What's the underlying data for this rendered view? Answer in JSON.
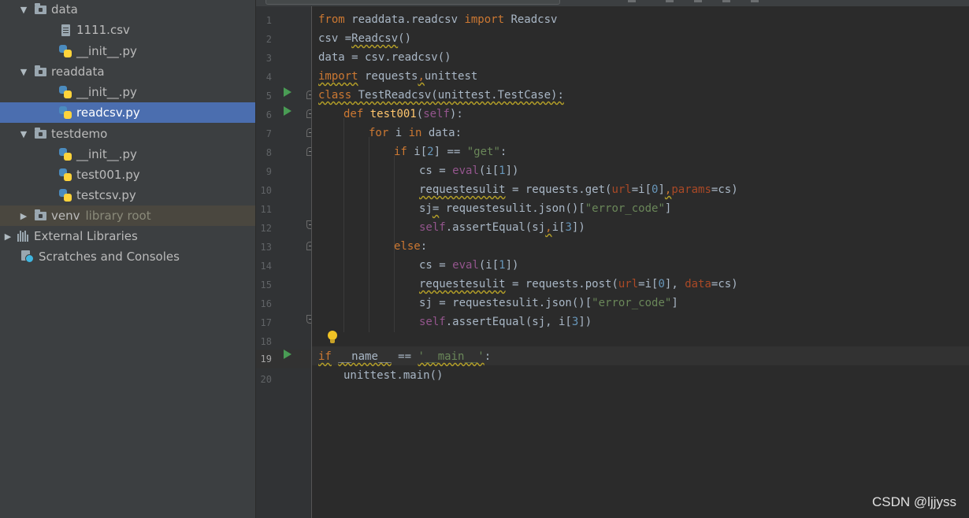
{
  "project_tree": {
    "items": [
      {
        "label": "data",
        "extra": "",
        "type": "folder",
        "expanded": true
      },
      {
        "label": "1111.csv",
        "extra": "",
        "type": "file-csv"
      },
      {
        "label": "__init__.py",
        "extra": "",
        "type": "file-py"
      },
      {
        "label": "readdata",
        "extra": "",
        "type": "folder",
        "expanded": true
      },
      {
        "label": "__init__.py",
        "extra": "",
        "type": "file-py"
      },
      {
        "label": "readcsv.py",
        "extra": "",
        "type": "file-py",
        "selected": true
      },
      {
        "label": "testdemo",
        "extra": "",
        "type": "folder",
        "expanded": true
      },
      {
        "label": "__init__.py",
        "extra": "",
        "type": "file-py"
      },
      {
        "label": "test001.py",
        "extra": "",
        "type": "file-py"
      },
      {
        "label": "testcsv.py",
        "extra": "",
        "type": "file-py"
      },
      {
        "label": "venv",
        "extra": "library root",
        "type": "folder",
        "expanded": false
      },
      {
        "label": "External Libraries",
        "extra": "",
        "type": "libraries",
        "expanded": false
      },
      {
        "label": "Scratches and Consoles",
        "extra": "",
        "type": "scratches"
      }
    ]
  },
  "editor": {
    "line_numbers": [
      "1",
      "2",
      "3",
      "4",
      "5",
      "6",
      "7",
      "8",
      "9",
      "10",
      "11",
      "12",
      "13",
      "14",
      "15",
      "16",
      "17",
      "18",
      "19",
      "20"
    ],
    "current_line": 19,
    "tokens": {
      "l1a": "from",
      "l1b": " readdata.readcsv ",
      "l1c": "import",
      "l1d": " Readcsv",
      "l2a": "csv =",
      "l2b": "Readcsv",
      "l2c": "()",
      "l3a": "data = csv.readcsv()",
      "l4a": "import",
      "l4b": " requests",
      "l4c": ",",
      "l4d": "unittest",
      "l5a": "class",
      "l5b": " TestReadcsv(unittest.TestCase):",
      "l6a": "def",
      "l6b": " ",
      "l6c": "test001",
      "l6d": "(",
      "l6e": "self",
      "l6f": "):",
      "l7a": "for",
      "l7b": " i ",
      "l7c": "in",
      "l7d": " data:",
      "l8a": "if",
      "l8b": " i[",
      "l8c": "2",
      "l8d": "] == ",
      "l8e": "\"get\"",
      "l8f": ":",
      "l9a": "cs = ",
      "l9b": "eval",
      "l9c": "(i[",
      "l9d": "1",
      "l9e": "])",
      "l10a": "requestesulit",
      "l10b": " = requests.get(",
      "l10c": "url",
      "l10d": "=i[",
      "l10e": "0",
      "l10f": "]",
      "l10g": ",",
      "l10h": "params",
      "l10i": "=cs)",
      "l11a": "sj",
      "l11b": "=",
      "l11c": " requestesulit.json()[",
      "l11d": "\"error_code\"",
      "l11e": "]",
      "l12a": "self",
      "l12b": ".assertEqual(sj",
      "l12c": ",",
      "l12d": "i[",
      "l12e": "3",
      "l12f": "])",
      "l13a": "else",
      "l13b": ":",
      "l14a": "cs = ",
      "l14b": "eval",
      "l14c": "(i[",
      "l14d": "1",
      "l14e": "])",
      "l15a": "requestesulit",
      "l15b": " = requests.post(",
      "l15c": "url",
      "l15d": "=i[",
      "l15e": "0",
      "l15f": "], ",
      "l15g": "data",
      "l15h": "=cs)",
      "l16a": "sj = requestesulit.json()[",
      "l16b": "\"error_code\"",
      "l16c": "]",
      "l17a": "self",
      "l17b": ".assertEqual(sj, i[",
      "l17c": "3",
      "l17d": "])",
      "l19a": "if",
      "l19b": " ",
      "l19c": "__name__",
      "l19d": " == ",
      "l19e": "'__main__'",
      "l19f": ":",
      "l20a": "unittest.main()"
    }
  },
  "watermark": "CSDN @ljjyss"
}
